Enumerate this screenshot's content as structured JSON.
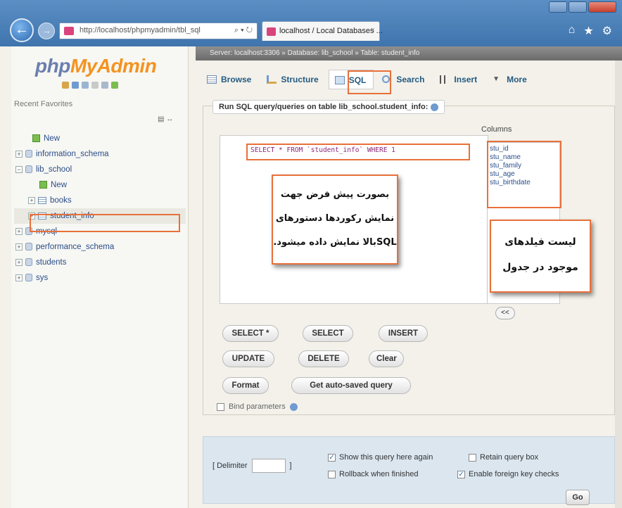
{
  "browser": {
    "address": "http://localhost/phpmyadmin/tbl_sql",
    "address_tools": "⌕ ▾ ↻",
    "tab_title": "localhost / Local Databases ...",
    "tab_close": "×"
  },
  "sidebar": {
    "logo_php": "php",
    "logo_my": "MyAdmin",
    "recent_favorites": "Recent   Favorites",
    "tree": [
      {
        "label": "New",
        "type": "new",
        "indent": 1
      },
      {
        "label": "information_schema",
        "type": "db",
        "indent": 0
      },
      {
        "label": "lib_school",
        "type": "db",
        "indent": 0
      },
      {
        "label": "New",
        "type": "new",
        "indent": 2
      },
      {
        "label": "books",
        "type": "table",
        "indent": 1
      },
      {
        "label": "student_info",
        "type": "table",
        "indent": 1
      },
      {
        "label": "mysql",
        "type": "db",
        "indent": 0
      },
      {
        "label": "performance_schema",
        "type": "db",
        "indent": 0
      },
      {
        "label": "students",
        "type": "db",
        "indent": 0
      },
      {
        "label": "sys",
        "type": "db",
        "indent": 0
      }
    ]
  },
  "main": {
    "breadcrumb": "Server: localhost:3306 » Database: lib_school » Table: student_info",
    "tabs": [
      {
        "label": "Browse",
        "name": "tab-browse",
        "active": false
      },
      {
        "label": "Structure",
        "name": "tab-structure",
        "active": false
      },
      {
        "label": "SQL",
        "name": "tab-sql",
        "active": true
      },
      {
        "label": "Search",
        "name": "tab-search",
        "active": false
      },
      {
        "label": "Insert",
        "name": "tab-insert",
        "active": false
      },
      {
        "label": "More",
        "name": "tab-more",
        "active": false
      }
    ],
    "legend": "Run SQL query/queries on table lib_school.student_info:",
    "columns_label": "Columns",
    "sql_text": "SELECT * FROM `student_info` WHERE 1",
    "columns": [
      "stu_id",
      "stu_name",
      "stu_family",
      "stu_age",
      "stu_birthdate"
    ],
    "insert_button": "<<",
    "callout_sql": [
      "بصورت پیش فرض جهت",
      "نمایش رکوردها دستورهای",
      "SQLبالا نمایش داده میشود."
    ],
    "callout_fields": [
      "لیست فیلدهای",
      "موجود در جدول"
    ],
    "buttons": {
      "select_star": "SELECT *",
      "select": "SELECT",
      "insert": "INSERT",
      "update": "UPDATE",
      "delete": "DELETE",
      "clear": "Clear",
      "format": "Format",
      "get_autosaved": "Get auto-saved query"
    },
    "bind_parameters": "Bind parameters",
    "delimiter_label": "[ Delimiter",
    "delimiter_close": "]",
    "options": {
      "show_query": "Show this query here again",
      "retain_box": "Retain query box",
      "rollback": "Rollback when finished",
      "foreign_keys": "Enable foreign key checks"
    },
    "go_button": "Go"
  },
  "colors": {
    "highlight": "#e8703a",
    "link": "#235a81"
  }
}
